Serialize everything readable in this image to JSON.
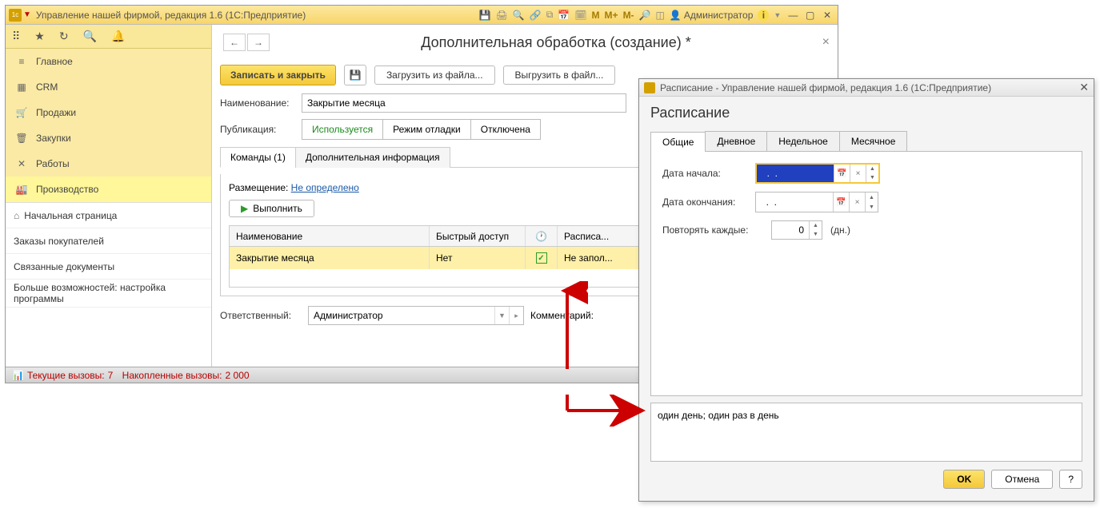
{
  "window": {
    "title": "Управление нашей фирмой, редакция 1.6  (1С:Предприятие)",
    "admin_label": "Администратор",
    "m_buttons": [
      "M",
      "M+",
      "M-"
    ]
  },
  "sidebar": {
    "sections": [
      {
        "icon": "≡",
        "label": "Главное"
      },
      {
        "icon": "▦",
        "label": "CRM"
      },
      {
        "icon": "🛒",
        "label": "Продажи"
      },
      {
        "icon": "🗑",
        "label": "Закупки"
      },
      {
        "icon": "✕",
        "label": "Работы"
      },
      {
        "icon": "🏭",
        "label": "Производство"
      }
    ],
    "subs": [
      "Начальная страница",
      "Заказы покупателей",
      "Связанные документы",
      "Больше возможностей: настройка программы"
    ]
  },
  "document": {
    "title": "Дополнительная обработка (создание) *",
    "save_close": "Записать и закрыть",
    "load_file": "Загрузить из файла...",
    "export_file": "Выгрузить в файл...",
    "name_label": "Наименование:",
    "name_value": "Закрытие месяца",
    "publication_label": "Публикация:",
    "publication_options": [
      "Используется",
      "Режим отладки",
      "Отключена"
    ],
    "tabs": [
      "Команды (1)",
      "Дополнительная информация"
    ],
    "placement_label": "Размещение:",
    "placement_value": "Не определено",
    "execute": "Выполнить",
    "table": {
      "headers": {
        "name": "Наименование",
        "access": "Быстрый доступ",
        "clock": "⏱",
        "sched": "Расписа..."
      },
      "row": {
        "name": "Закрытие месяца",
        "access": "Нет",
        "checked": true,
        "sched": "Не запол..."
      }
    },
    "responsible_label": "Ответственный:",
    "responsible_value": "Администратор",
    "comment_label": "Комментарий:"
  },
  "statusbar": {
    "current_label": "Текущие вызовы:",
    "current_value": "7",
    "accumulated_label": "Накопленные вызовы:",
    "accumulated_value": "2 000"
  },
  "dialog": {
    "title": "Расписание - Управление нашей фирмой, редакция 1.6  (1С:Предприятие)",
    "heading": "Расписание",
    "tabs": [
      "Общие",
      "Дневное",
      "Недельное",
      "Месячное"
    ],
    "start_label": "Дата начала:",
    "start_value": "  .  .    ",
    "end_label": "Дата окончания:",
    "end_value": "  .  .    ",
    "repeat_label": "Повторять каждые:",
    "repeat_value": "0",
    "repeat_unit": "(дн.)",
    "summary": "один день; один раз в день",
    "ok": "OK",
    "cancel": "Отмена",
    "help": "?"
  }
}
